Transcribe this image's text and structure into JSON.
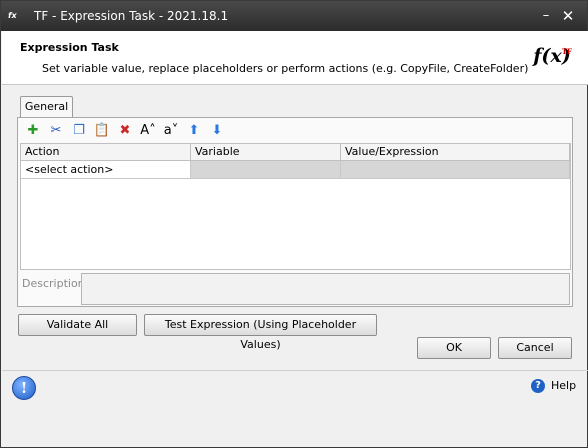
{
  "window": {
    "title": "TF - Expression Task - 2021.18.1",
    "minimize_glyph": "–",
    "close_glyph": "✕"
  },
  "header": {
    "title": "Expression Task",
    "description": "Set variable value, replace placeholders or perform actions (e.g. CopyFile, CreateFolder)",
    "logo_text": "f(x)"
  },
  "tabs": [
    {
      "label": "General",
      "active": true
    }
  ],
  "toolbar": [
    {
      "name": "add-icon",
      "glyph": "✚",
      "color": "#2a9a2a"
    },
    {
      "name": "cut-icon",
      "glyph": "✂",
      "color": "#2455b8"
    },
    {
      "name": "copy-icon",
      "glyph": "❐",
      "color": "#2d6fd1"
    },
    {
      "name": "paste-icon",
      "glyph": "📋",
      "color": "#d8a030"
    },
    {
      "name": "delete-icon",
      "glyph": "✖",
      "color": "#cc2a2a"
    },
    {
      "name": "font-increase-icon",
      "glyph": "A˄",
      "color": "#000000"
    },
    {
      "name": "font-decrease-icon",
      "glyph": "a˅",
      "color": "#000000"
    },
    {
      "name": "move-up-icon",
      "glyph": "⬆",
      "color": "#2b78e4"
    },
    {
      "name": "move-down-icon",
      "glyph": "⬇",
      "color": "#2b78e4"
    }
  ],
  "grid": {
    "columns": [
      "Action",
      "Variable",
      "Value/Expression"
    ],
    "rows": [
      [
        "<select action>",
        "",
        ""
      ]
    ]
  },
  "description_label": "Description",
  "buttons": {
    "validate_all": "Validate All",
    "test_expression": "Test Expression (Using Placeholder Values)",
    "ok": "OK",
    "cancel": "Cancel",
    "help": "Help"
  }
}
